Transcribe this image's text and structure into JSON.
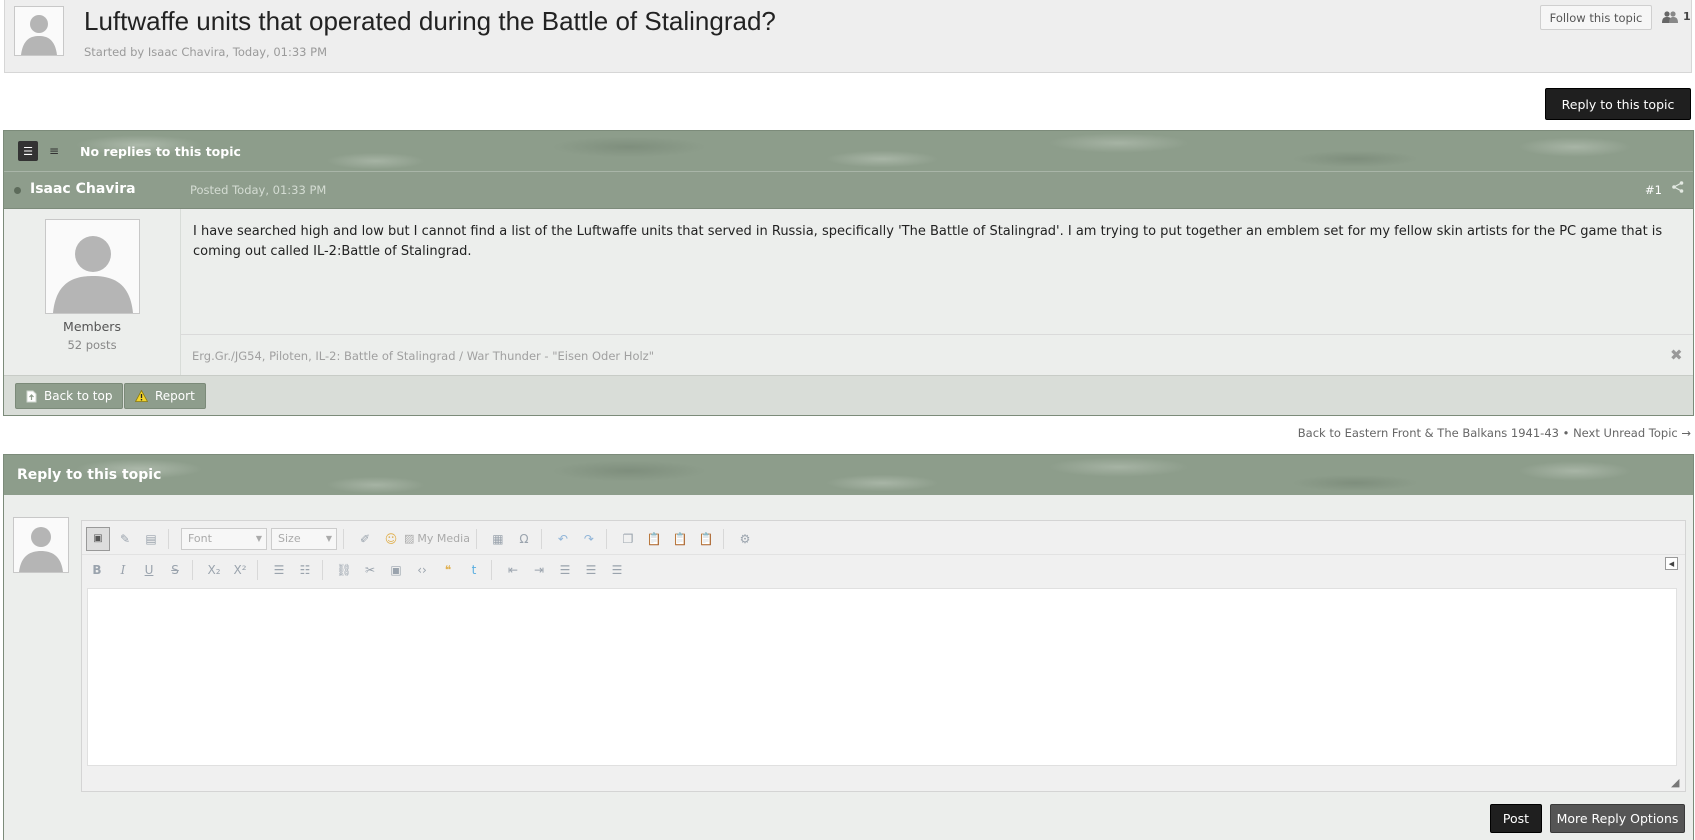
{
  "topic": {
    "title": "Luftwaffe units that operated during the Battle of Stalingrad?",
    "meta": "Started by Isaac Chavira, Today, 01:33 PM",
    "follow_label": "Follow this topic",
    "follower_count": "1",
    "reply_button": "Reply to this topic"
  },
  "thread": {
    "replies_text": "No replies to this topic"
  },
  "post": {
    "author": "Isaac Chavira",
    "posted": "Posted Today, 01:33 PM",
    "number": "#1",
    "member_group": "Members",
    "post_count": "52 posts",
    "body": "I have searched high and low but I cannot find a list of the Luftwaffe units that served in Russia, specifically 'The Battle of Stalingrad'. I am trying to put together an emblem set for my fellow skin artists for the PC game that is coming out called IL-2:Battle of Stalingrad.",
    "signature": "Erg.Gr./JG54, Piloten, IL-2: Battle of Stalingrad / War Thunder - \"Eisen Oder Holz\"",
    "back_to_top": "Back to top",
    "report": "Report"
  },
  "nav": {
    "back_link": "Back to Eastern Front & The Balkans 1941-43",
    "separator": "•",
    "next_link": "Next Unread Topic →"
  },
  "reply": {
    "title": "Reply to this topic",
    "font_placeholder": "Font",
    "size_placeholder": "Size",
    "my_media": "My Media",
    "post_button": "Post",
    "more_options_button": "More Reply Options"
  }
}
